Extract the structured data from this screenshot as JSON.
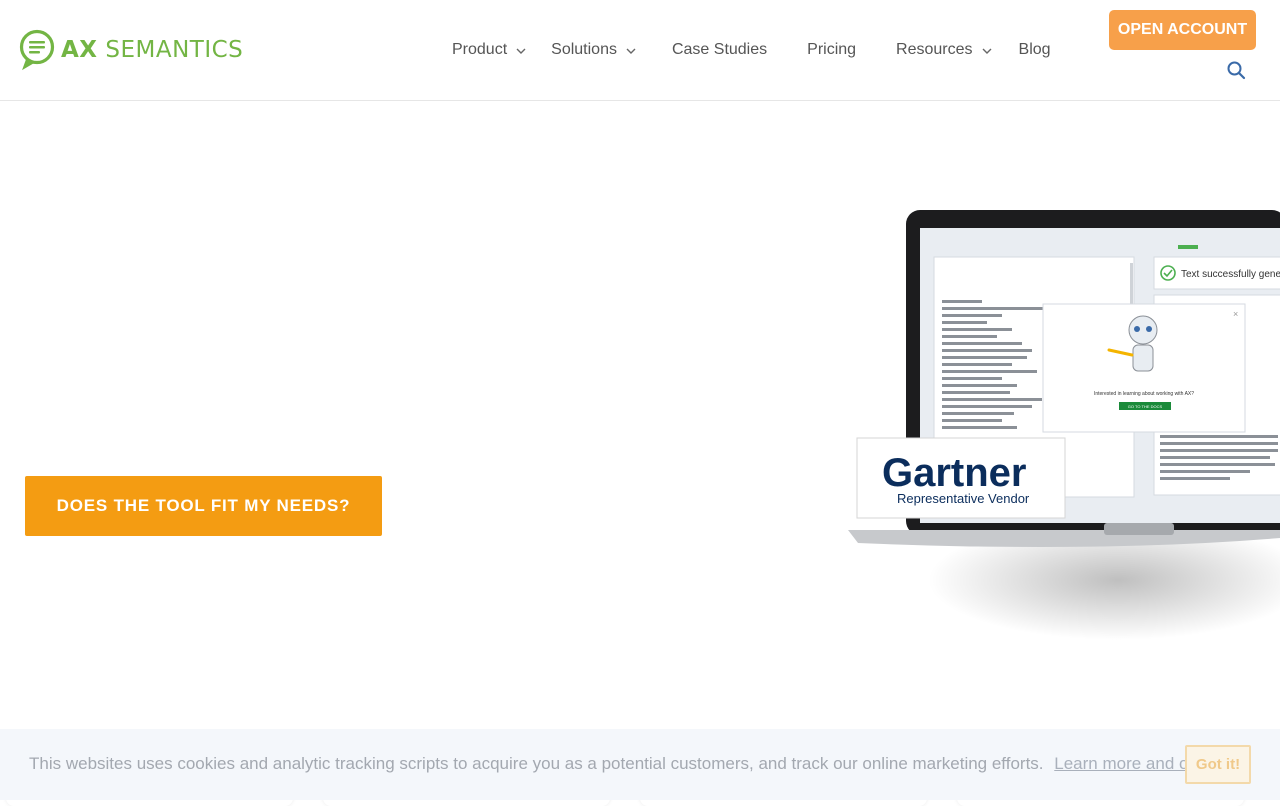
{
  "brand": {
    "logo_ax": "AX",
    "logo_semantics": "SEMANTICS",
    "color": "#73b544"
  },
  "nav": {
    "items": [
      {
        "label": "Product",
        "has_dropdown": true
      },
      {
        "label": "Solutions",
        "has_dropdown": true
      },
      {
        "label": "Case Studies",
        "has_dropdown": false
      },
      {
        "label": "Pricing",
        "has_dropdown": false
      },
      {
        "label": "Resources",
        "has_dropdown": true
      },
      {
        "label": "Blog",
        "has_dropdown": false
      }
    ],
    "cta_label": "OPEN ACCOUNT",
    "search_icon": "search-icon"
  },
  "hero": {
    "cta_label": "DOES THE TOOL FIT MY NEEDS?",
    "gartner_title": "Gartner",
    "gartner_subtitle": "Representative Vendor",
    "screen_status": "Text successfully generat",
    "modal_text": "Interested in learning about working with AX?",
    "modal_button": "GO TO THE DOCS"
  },
  "cookie_banner": {
    "text": "This websites uses cookies and analytic tracking scripts to acquire you as a potential customers, and track our online marketing efforts.",
    "link": "Learn more and opt-out.",
    "button": "Got it!"
  },
  "colors": {
    "accent_orange": "#f49c12",
    "top_cta_orange": "#f7a04a",
    "brand_green": "#73b544"
  }
}
